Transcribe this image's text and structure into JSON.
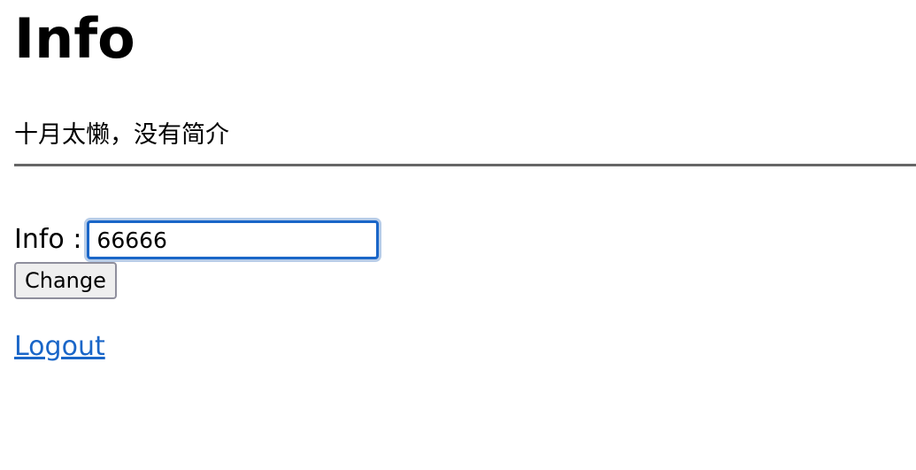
{
  "page": {
    "title": "Info",
    "description": "十月太懒，没有简介"
  },
  "form": {
    "label": "Info :",
    "input_value": "66666",
    "submit_label": "Change"
  },
  "links": {
    "logout": "Logout"
  },
  "colors": {
    "link": "#1a66c8",
    "focus_border": "#1a66c8",
    "divider": "#666666"
  }
}
